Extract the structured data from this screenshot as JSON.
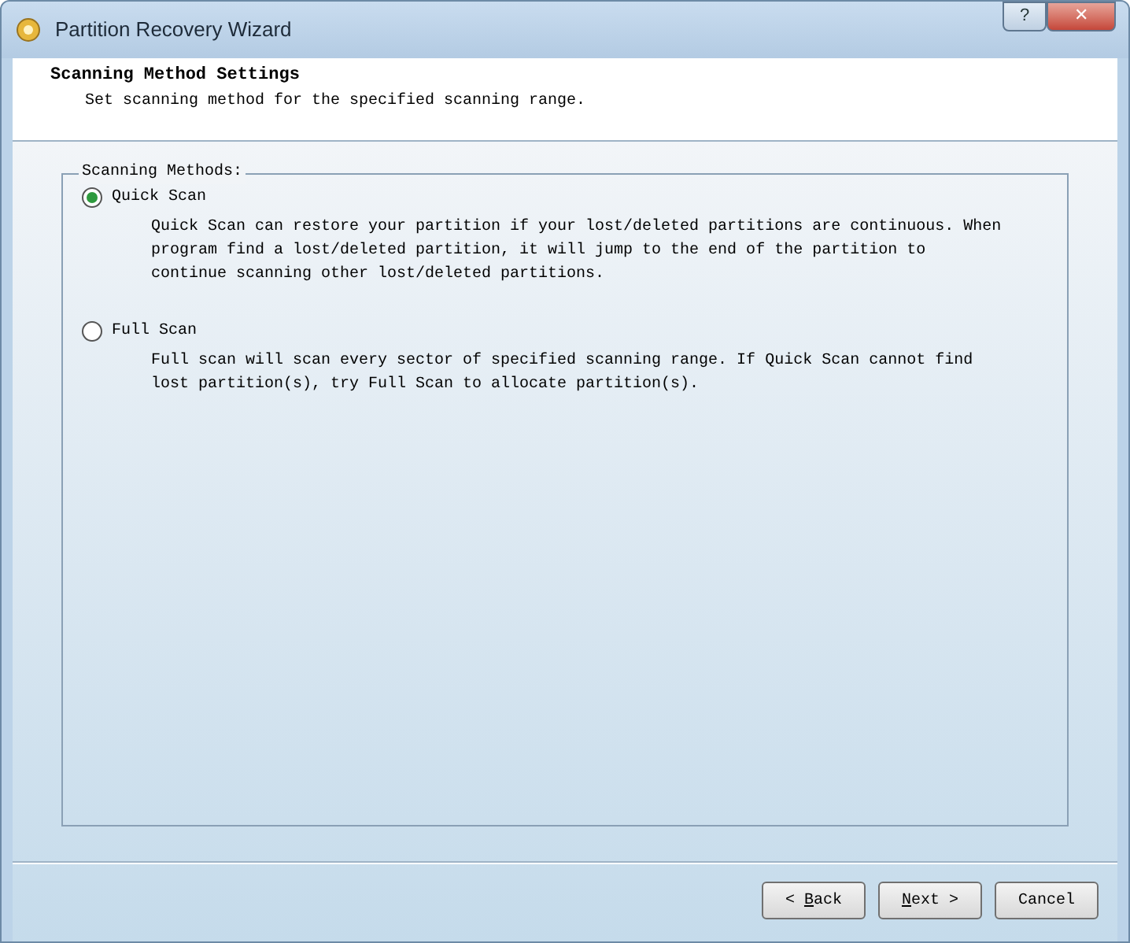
{
  "window": {
    "title": "Partition Recovery Wizard",
    "controls": [
      "?",
      "✕"
    ]
  },
  "header": {
    "title": "Scanning Method Settings",
    "subtitle": "Set scanning method for the specified scanning range."
  },
  "group": {
    "label": "Scanning Methods:",
    "options": [
      {
        "label": "Quick Scan",
        "selected": true,
        "description": "Quick Scan can restore your partition if your lost/deleted partitions are continuous. When program find a lost/deleted partition, it will jump to the end of the partition to continue scanning other lost/deleted partitions."
      },
      {
        "label": "Full Scan",
        "selected": false,
        "description": "Full scan will scan every sector of specified scanning range. If Quick Scan cannot find lost partition(s), try Full Scan to allocate partition(s)."
      }
    ]
  },
  "buttons": [
    {
      "label": "< Back",
      "kind": "back"
    },
    {
      "label": "Next >",
      "kind": "next"
    },
    {
      "label": "Cancel",
      "kind": "cancel"
    }
  ]
}
